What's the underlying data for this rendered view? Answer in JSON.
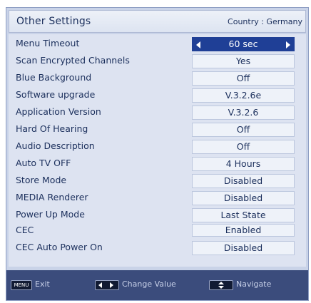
{
  "header": {
    "title": "Other Settings",
    "country": "Country : Germany"
  },
  "settings": [
    {
      "label": "Menu Timeout",
      "value": "60 sec",
      "selected": true
    },
    {
      "label": "Scan Encrypted Channels",
      "value": "Yes"
    },
    {
      "label": "Blue Background",
      "value": "Off"
    },
    {
      "label": "Software upgrade",
      "value": "V.3.2.6e"
    },
    {
      "label": "Application Version",
      "value": "V.3.2.6"
    },
    {
      "label": "Hard Of Hearing",
      "value": "Off"
    },
    {
      "label": "Audio Description",
      "value": "Off"
    },
    {
      "label": "Auto TV OFF",
      "value": "4 Hours"
    },
    {
      "label": "Store Mode",
      "value": "Disabled"
    },
    {
      "label": "MEDIA Renderer",
      "value": "Disabled"
    },
    {
      "label": "Power Up Mode",
      "value": "Last State"
    },
    {
      "label": "CEC",
      "value": "Enabled"
    },
    {
      "label": "CEC  Auto Power On",
      "value": "Disabled"
    }
  ],
  "footer": {
    "menu_key": "MENU",
    "exit_label": "Exit",
    "change_value_label": "Change Value",
    "navigate_label": "Navigate"
  },
  "colors": {
    "panel_bg": "#dde3f1",
    "selected_bg": "#1f3f96",
    "footer_bg": "#3b4c7c",
    "text": "#1b2f5c"
  }
}
